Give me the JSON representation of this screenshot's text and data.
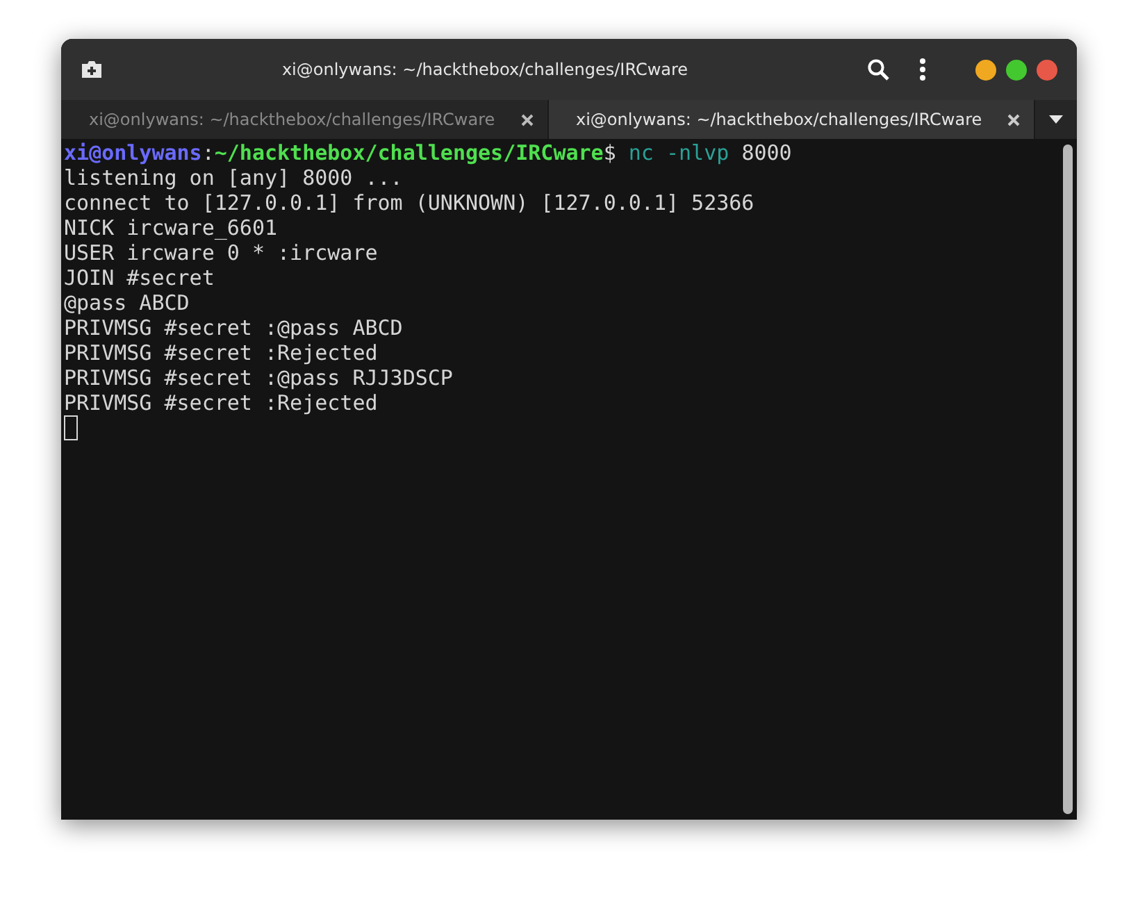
{
  "window": {
    "title": "xi@onlywans: ~/hackthebox/challenges/IRCware"
  },
  "tabs": [
    {
      "label": "xi@onlywans: ~/hackthebox/challenges/IRCware",
      "selected": false
    },
    {
      "label": "xi@onlywans: ~/hackthebox/challenges/IRCware",
      "selected": true
    }
  ],
  "terminal": {
    "prompt": {
      "user": "xi@onlywans",
      "separator": ":",
      "path": "~/hackthebox/challenges/IRCware",
      "symbol": "$",
      "command": "nc -nlvp",
      "argument": "8000"
    },
    "lines": [
      "listening on [any] 8000 ...",
      "connect to [127.0.0.1] from (UNKNOWN) [127.0.0.1] 52366",
      "NICK ircware_6601",
      "USER ircware 0 * :ircware",
      "JOIN #secret",
      "@pass ABCD",
      "PRIVMSG #secret :@pass ABCD",
      "PRIVMSG #secret :Rejected",
      "PRIVMSG #secret :@pass RJJ3DSCP",
      "PRIVMSG #secret :Rejected"
    ]
  }
}
